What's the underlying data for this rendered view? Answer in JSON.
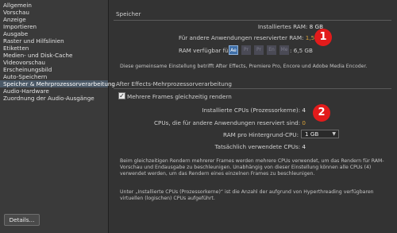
{
  "sidebar": {
    "items": [
      {
        "label": "Allgemein"
      },
      {
        "label": "Vorschau"
      },
      {
        "label": "Anzeige"
      },
      {
        "label": "Importieren"
      },
      {
        "label": "Ausgabe"
      },
      {
        "label": "Raster und Hilfslinien"
      },
      {
        "label": "Etiketten"
      },
      {
        "label": "Medien- und Disk-Cache"
      },
      {
        "label": "Videovorschau"
      },
      {
        "label": "Erscheinungsbild"
      },
      {
        "label": "Auto-Speichern"
      },
      {
        "label": "Speicher & Mehrprozessorverarbeitung",
        "selected": true
      },
      {
        "label": "Audio-Hardware"
      },
      {
        "label": "Zuordnung der Audio-Ausgänge"
      }
    ]
  },
  "memory": {
    "title": "Speicher",
    "installed_label": "Installiertes RAM:",
    "installed_value": "8 GB",
    "reserved_label": "Für andere Anwendungen reservierter RAM:",
    "reserved_value": "1,5",
    "reserved_unit": "GB",
    "available_label": "RAM verfügbar für",
    "available_value": ": 6,5 GB",
    "apps": [
      "Ae",
      "Pr",
      "Pr",
      "En",
      "Me"
    ],
    "note": "Diese gemeinsame Einstellung betrifft After Effects, Premiere Pro, Encore und Adobe Media Encoder.",
    "badge": "1"
  },
  "mp": {
    "title": "After Effects-Mehrprozessorverarbeitung",
    "checkbox_label": "Mehrere Frames gleichzeitig rendern",
    "cpus_label": "Installierte CPUs (Prozessorkerne):",
    "cpus_value": "4",
    "reserved_cpus_label": "CPUs, die für andere Anwendungen reserviert sind:",
    "reserved_cpus_value": "0",
    "ram_per_cpu_label": "RAM pro Hintergrund-CPU:",
    "ram_per_cpu_value": "1 GB",
    "actual_cpus_label": "Tatsächlich verwendete CPUs:",
    "actual_cpus_value": "4",
    "note1": "Beim gleichzeitigen Rendern mehrerer Frames werden mehrere CPUs verwendet, um das Rendern für RAM-Vorschau und Endausgabe zu beschleunigen. Unabhängig von dieser Einstellung können alle CPUs (4) verwendet werden, um das Rendern eines einzelnen Frames zu beschleunigen.",
    "note2": "Unter „Installierte CPUs (Prozessorkerne)“ ist die Anzahl der aufgrund von Hyperthreading verfügbaren virtuellen (logischen) CPUs aufgeführt.",
    "badge": "2"
  },
  "details_button": "Details..."
}
